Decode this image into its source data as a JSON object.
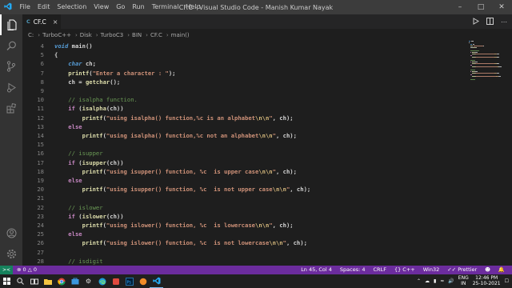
{
  "titlebar": {
    "menu": [
      "File",
      "Edit",
      "Selection",
      "View",
      "Go",
      "Run",
      "Terminal",
      "Help"
    ],
    "window_title": "CF.C - Visual Studio Code - Manish Kumar Nayak"
  },
  "tab": {
    "label": "CF.C",
    "icon_text": "C"
  },
  "breadcrumbs": [
    "C:",
    "TurboC++",
    "Disk",
    "TurboC3",
    "BIN",
    "CF.C",
    "main()"
  ],
  "code_lines": [
    {
      "n": "4",
      "tokens": [
        [
          "kw",
          "void"
        ],
        [
          "id",
          " main()"
        ]
      ]
    },
    {
      "n": "5",
      "tokens": [
        [
          "id",
          "{"
        ]
      ]
    },
    {
      "n": "6",
      "tokens": [
        [
          "kw",
          "    char"
        ],
        [
          "id",
          " ch;"
        ]
      ]
    },
    {
      "n": "7",
      "tokens": [
        [
          "fn",
          "    printf"
        ],
        [
          "id",
          "("
        ],
        [
          "str",
          "\"Enter a character : \""
        ],
        [
          "id",
          ");"
        ]
      ]
    },
    {
      "n": "8",
      "tokens": [
        [
          "id",
          "    ch = "
        ],
        [
          "fn",
          "getchar"
        ],
        [
          "id",
          "();"
        ]
      ]
    },
    {
      "n": "9",
      "tokens": []
    },
    {
      "n": "10",
      "tokens": [
        [
          "cm",
          "    // isalpha function."
        ]
      ]
    },
    {
      "n": "11",
      "tokens": [
        [
          "ctl",
          "    if"
        ],
        [
          "id",
          " ("
        ],
        [
          "fn",
          "isalpha"
        ],
        [
          "id",
          "(ch))"
        ]
      ]
    },
    {
      "n": "12",
      "tokens": [
        [
          "fn",
          "        printf"
        ],
        [
          "id",
          "("
        ],
        [
          "str",
          "\"using isalpha() function,%c is an alphabet"
        ],
        [
          "esc",
          "\\n\\n"
        ],
        [
          "str",
          "\""
        ],
        [
          "id",
          ", ch);"
        ]
      ]
    },
    {
      "n": "13",
      "tokens": [
        [
          "ctl",
          "    else"
        ]
      ]
    },
    {
      "n": "14",
      "tokens": [
        [
          "fn",
          "        printf"
        ],
        [
          "id",
          "("
        ],
        [
          "str",
          "\"using isalpha() function,%c not an alphabet"
        ],
        [
          "esc",
          "\\n\\n"
        ],
        [
          "str",
          "\""
        ],
        [
          "id",
          ", ch);"
        ]
      ]
    },
    {
      "n": "15",
      "tokens": []
    },
    {
      "n": "16",
      "tokens": [
        [
          "cm",
          "    // isupper"
        ]
      ]
    },
    {
      "n": "17",
      "tokens": [
        [
          "ctl",
          "    if"
        ],
        [
          "id",
          " ("
        ],
        [
          "fn",
          "isupper"
        ],
        [
          "id",
          "(ch))"
        ]
      ]
    },
    {
      "n": "18",
      "tokens": [
        [
          "fn",
          "        printf"
        ],
        [
          "id",
          "("
        ],
        [
          "str",
          "\"using isupper() function, %c  is upper case"
        ],
        [
          "esc",
          "\\n\\n"
        ],
        [
          "str",
          "\""
        ],
        [
          "id",
          ", ch);"
        ]
      ]
    },
    {
      "n": "19",
      "tokens": [
        [
          "ctl",
          "    else"
        ]
      ]
    },
    {
      "n": "20",
      "tokens": [
        [
          "fn",
          "        printf"
        ],
        [
          "id",
          "("
        ],
        [
          "str",
          "\"using isupper() function, %c  is not upper case"
        ],
        [
          "esc",
          "\\n\\n"
        ],
        [
          "str",
          "\""
        ],
        [
          "id",
          ", ch);"
        ]
      ]
    },
    {
      "n": "21",
      "tokens": []
    },
    {
      "n": "22",
      "tokens": [
        [
          "cm",
          "    // islower"
        ]
      ]
    },
    {
      "n": "23",
      "tokens": [
        [
          "ctl",
          "    if"
        ],
        [
          "id",
          " ("
        ],
        [
          "fn",
          "islower"
        ],
        [
          "id",
          "(ch))"
        ]
      ]
    },
    {
      "n": "24",
      "tokens": [
        [
          "fn",
          "        printf"
        ],
        [
          "id",
          "("
        ],
        [
          "str",
          "\"using islower() function, %c  is lowercase"
        ],
        [
          "esc",
          "\\n\\n"
        ],
        [
          "str",
          "\""
        ],
        [
          "id",
          ", ch);"
        ]
      ]
    },
    {
      "n": "25",
      "tokens": [
        [
          "ctl",
          "    else"
        ]
      ]
    },
    {
      "n": "26",
      "tokens": [
        [
          "fn",
          "        printf"
        ],
        [
          "id",
          "("
        ],
        [
          "str",
          "\"using islower() function, %c  is not lowercase"
        ],
        [
          "esc",
          "\\n\\n"
        ],
        [
          "str",
          "\""
        ],
        [
          "id",
          ", ch);"
        ]
      ]
    },
    {
      "n": "27",
      "tokens": []
    },
    {
      "n": "28",
      "tokens": [
        [
          "cm",
          "    // isdigit"
        ]
      ]
    }
  ],
  "status": {
    "errors": "0",
    "warnings": "0",
    "position": "Ln 45, Col 4",
    "spaces": "Spaces: 4",
    "eol": "CRLF",
    "language": "C++",
    "platform": "Win32",
    "prettier": "Prettier"
  },
  "tray": {
    "lang": "ENG",
    "region": "IN",
    "time": "12:46 PM",
    "date": "25-10-2021"
  },
  "colors": {
    "statusbar": "#6c2c9e",
    "titlebar": "#3c3c3c",
    "editor": "#1e1e1e",
    "activitybar": "#333333"
  }
}
